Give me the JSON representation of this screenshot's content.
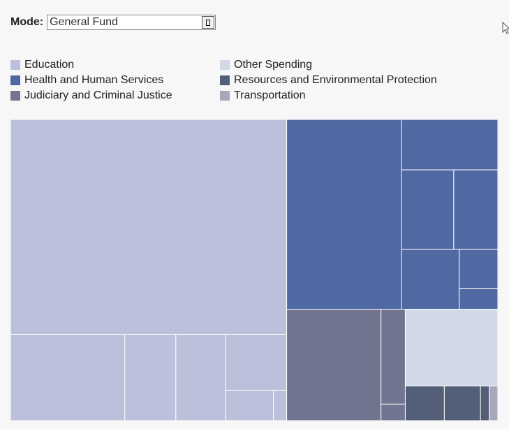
{
  "mode": {
    "label": "Mode:",
    "selected": "General Fund"
  },
  "legend": [
    {
      "name": "Education",
      "color": "#bbc1da"
    },
    {
      "name": "Other Spending",
      "color": "#d1d8e6"
    },
    {
      "name": "Health and Human Services",
      "color": "#5169a2"
    },
    {
      "name": "Resources and Environmental Protection",
      "color": "#535e78"
    },
    {
      "name": "Judiciary and Criminal Justice",
      "color": "#727590"
    },
    {
      "name": "Transportation",
      "color": "#a7a9bb"
    }
  ],
  "chart_data": {
    "type": "treemap",
    "title": "",
    "categories": [
      {
        "name": "Education",
        "color": "#bbc1da",
        "items": [
          {
            "value": 118.5
          },
          {
            "value": 19.7
          },
          {
            "value": 8.8
          },
          {
            "value": 8.6
          },
          {
            "value": 6.8
          },
          {
            "value": 2.9
          },
          {
            "value": 0.8
          }
        ]
      },
      {
        "name": "Health and Human Services",
        "color": "#5169a2",
        "items": [
          {
            "value": 43.5
          },
          {
            "value": 9.7
          },
          {
            "value": 8.3
          },
          {
            "value": 7.0
          },
          {
            "value": 6.9
          },
          {
            "value": 3.0
          },
          {
            "value": 1.6
          }
        ]
      },
      {
        "name": "Judiciary and Criminal Justice",
        "color": "#727590",
        "items": [
          {
            "value": 21.0
          },
          {
            "value": 4.6
          },
          {
            "value": 0.8
          }
        ]
      },
      {
        "name": "Other Spending",
        "color": "#d1d8e6",
        "items": [
          {
            "value": 14.2
          }
        ]
      },
      {
        "name": "Resources and Environmental Protection",
        "color": "#535e78",
        "items": [
          {
            "value": 2.7
          },
          {
            "value": 2.5
          },
          {
            "value": 0.6
          }
        ]
      },
      {
        "name": "Transportation",
        "color": "#a7a9bb",
        "items": [
          {
            "value": 0.6
          }
        ]
      }
    ]
  }
}
